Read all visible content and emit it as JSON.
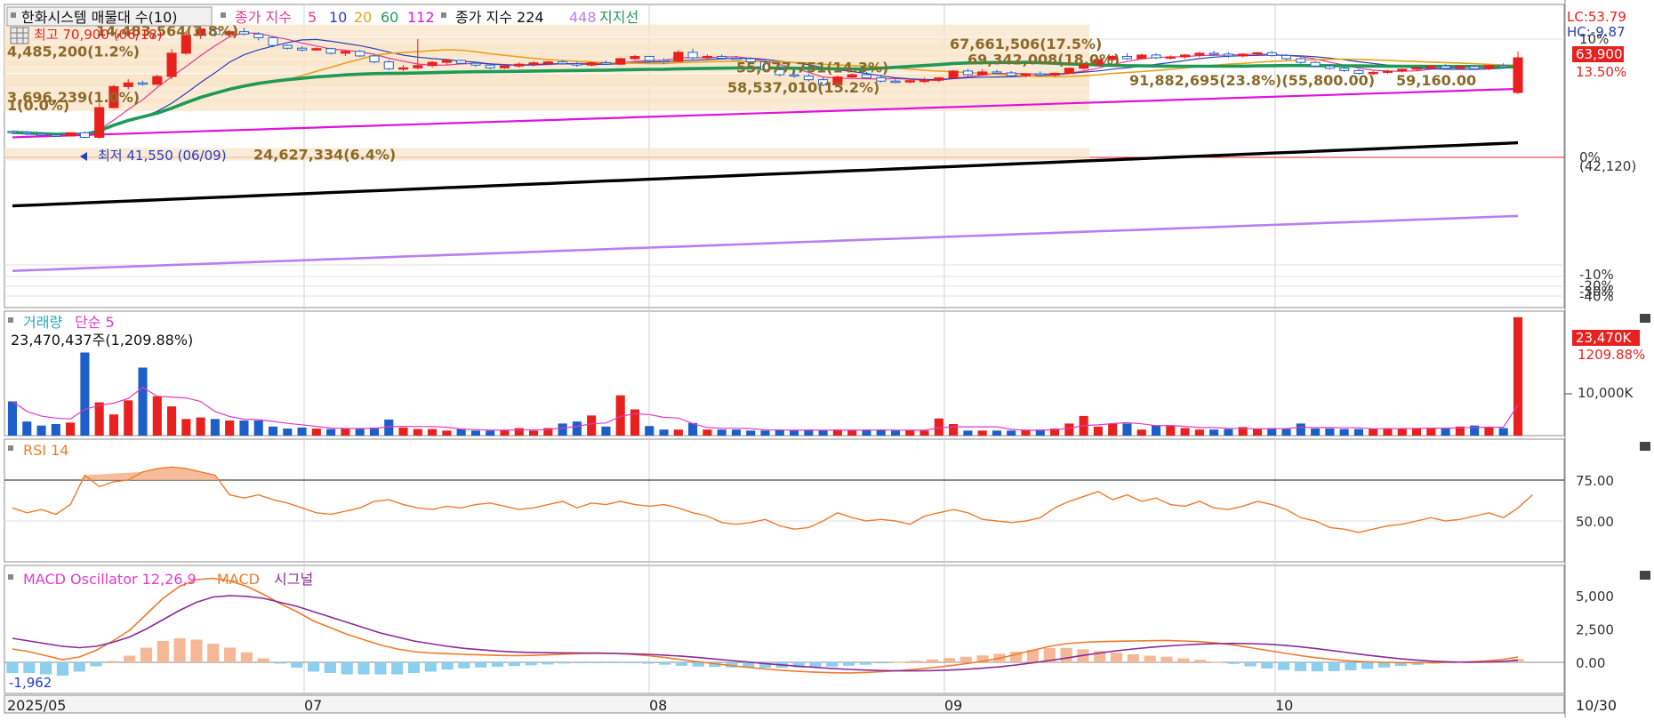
{
  "colors": {
    "up": "#e8201e",
    "down": "#1e5ec8",
    "ma5": "#e03a96",
    "ma10": "#2a3fb8",
    "ma20": "#e8a21c",
    "ma60": "#1e9a56",
    "ma112": "#e010e0",
    "ma224": "#000000",
    "ma448": "#b87ff0",
    "rsi": "#f07a2a",
    "macd": "#f07a2a",
    "signal": "#8a2a9a",
    "osc_pos": "#f5b896",
    "osc_neg": "#8ccfee",
    "volume_ma": "#e03ac8",
    "profile_band": "#f8e4c8",
    "annotation": "#8a6a2a"
  },
  "price_panel": {
    "legend": {
      "title": "한화시스템 매물대 수(10)",
      "ma_label": "종가 지수",
      "ma_periods": [
        "5",
        "10",
        "20",
        "60",
        "112"
      ],
      "ma2_label": "종가 지수 224",
      "ma2_extra": "448",
      "support": "지지선"
    },
    "high_label": "최고 70,900 (06/18)",
    "low_label": "최저 41,550 (06/09)",
    "lc_label": "LC:53.79",
    "hc_label": "HC:-9.87",
    "current_price": "63,900",
    "current_change": "13.50%",
    "right_scale": [
      {
        "label": "10%",
        "price": 67980
      },
      {
        "label": "0%",
        "price": 42120
      },
      {
        "label": "(42,120)",
        "price": 40150
      },
      {
        "label": "-10%",
        "price": 16500
      },
      {
        "label": "-20%",
        "price": 14000
      },
      {
        "label": "-30%",
        "price": 12800
      },
      {
        "label": "-40%",
        "price": 11700
      }
    ],
    "volume_profile": [
      {
        "label": "14,483,564(3.8%)",
        "price": 69800
      },
      {
        "label": "67,661,506(17.5%)",
        "price": 67000
      },
      {
        "label": "4,485,200(1.2%)",
        "price": 65400
      },
      {
        "label": "69,342,008(18.0%)",
        "price": 63600
      },
      {
        "label": "55,077,751(14.3%)",
        "price": 61900
      },
      {
        "label": "91,882,695(23.8%)(55,800.00)",
        "price": 59000
      },
      {
        "label": "59,160.00",
        "price": 59000
      },
      {
        "label": "58,537,010(15.2%)",
        "price": 57500
      },
      {
        "label": "3,696,239(1.0%)",
        "price": 55300
      },
      {
        "label": "1(0.0%)",
        "price": 53600
      },
      {
        "label": "24,627,334(6.4%)",
        "price": 42800
      }
    ]
  },
  "volume_panel": {
    "legend_label": "거래량",
    "legend_ma": "단순 5",
    "current": "23,470,437주(1,209.88%)",
    "badge": "23,470K",
    "badge_pct": "1209.88%",
    "scale_label": "10,000K"
  },
  "rsi_panel": {
    "legend": "RSI 14",
    "scale": [
      "75.00",
      "50.00"
    ]
  },
  "macd_panel": {
    "legend_osc": "MACD Oscillator 12,26,9",
    "legend_macd": "MACD",
    "legend_signal": "시그널",
    "min_label": "-1,962",
    "scale": [
      "5,000",
      "2,500",
      "0.00"
    ]
  },
  "x_axis": {
    "labels": [
      "2025/05",
      "07",
      "08",
      "09",
      "10"
    ],
    "end_label": "10/30"
  },
  "chart_data": {
    "type": "candlestick",
    "title": "한화시스템 매물대 수(10)",
    "dates_from": "2025/05",
    "dates_to": "10/30",
    "price_ylim": [
      11700,
      72000
    ],
    "candles": [
      [
        47800,
        48000,
        47200,
        47600
      ],
      [
        47600,
        47900,
        47000,
        47300
      ],
      [
        47300,
        47500,
        46700,
        47000
      ],
      [
        47000,
        47200,
        46600,
        46800
      ],
      [
        46800,
        47600,
        46700,
        47500
      ],
      [
        47500,
        47800,
        46300,
        46500
      ],
      [
        46500,
        54000,
        46200,
        53000
      ],
      [
        53000,
        58000,
        52800,
        57600
      ],
      [
        57600,
        59200,
        57000,
        58400
      ],
      [
        58400,
        58900,
        57800,
        58100
      ],
      [
        58100,
        60200,
        57800,
        59800
      ],
      [
        59800,
        65800,
        59200,
        64900
      ],
      [
        64900,
        69800,
        64600,
        68800
      ],
      [
        68800,
        70900,
        68000,
        70200
      ],
      [
        70200,
        70600,
        68500,
        69000
      ],
      [
        69000,
        69800,
        68400,
        69600
      ],
      [
        69600,
        70400,
        68800,
        69100
      ],
      [
        69100,
        69500,
        67700,
        68300
      ],
      [
        68300,
        68600,
        66200,
        66600
      ],
      [
        66600,
        66800,
        65700,
        66000
      ],
      [
        66000,
        66400,
        65300,
        65600
      ],
      [
        65600,
        66200,
        65400,
        65900
      ],
      [
        65900,
        66100,
        64600,
        64900
      ],
      [
        64900,
        65500,
        64300,
        65300
      ],
      [
        65300,
        65600,
        64100,
        64300
      ],
      [
        64300,
        64500,
        62700,
        63000
      ],
      [
        63000,
        63400,
        61200,
        61500
      ],
      [
        61500,
        62300,
        61000,
        61700
      ],
      [
        61700,
        68000,
        61300,
        62200
      ],
      [
        62200,
        63200,
        61800,
        62900
      ],
      [
        62900,
        63600,
        62300,
        63300
      ],
      [
        63300,
        63500,
        62500,
        62700
      ],
      [
        62700,
        63000,
        61900,
        62300
      ],
      [
        62300,
        62600,
        61400,
        61700
      ],
      [
        61700,
        62300,
        61500,
        62100
      ],
      [
        62100,
        62900,
        61700,
        62500
      ],
      [
        62500,
        63100,
        62000,
        62800
      ],
      [
        62800,
        63200,
        62300,
        63000
      ],
      [
        63000,
        63400,
        62400,
        62600
      ],
      [
        62600,
        63000,
        61900,
        62300
      ],
      [
        62300,
        63100,
        62000,
        62800
      ],
      [
        62800,
        63300,
        62300,
        62500
      ],
      [
        62500,
        63900,
        62300,
        63700
      ],
      [
        63700,
        64500,
        63400,
        64200
      ],
      [
        64200,
        64300,
        62800,
        63300
      ],
      [
        63300,
        63800,
        62600,
        63100
      ],
      [
        63100,
        65600,
        62900,
        65100
      ],
      [
        65100,
        65900,
        63500,
        63900
      ],
      [
        63900,
        64600,
        63400,
        64200
      ],
      [
        64200,
        64600,
        63500,
        63800
      ],
      [
        63800,
        64300,
        63400,
        63700
      ],
      [
        63700,
        64000,
        62600,
        63000
      ],
      [
        63000,
        63500,
        61000,
        61300
      ],
      [
        61300,
        61800,
        59800,
        60200
      ],
      [
        60200,
        60600,
        59500,
        59900
      ],
      [
        59900,
        60400,
        58700,
        59100
      ],
      [
        59100,
        59600,
        57700,
        58000
      ],
      [
        58000,
        60000,
        57900,
        59700
      ],
      [
        59700,
        60500,
        59500,
        60200
      ],
      [
        60200,
        60800,
        59300,
        59500
      ],
      [
        59500,
        60200,
        58500,
        58800
      ],
      [
        58800,
        59300,
        58300,
        58600
      ],
      [
        58600,
        59200,
        58300,
        58900
      ],
      [
        58900,
        59500,
        58400,
        59000
      ],
      [
        59000,
        59700,
        58600,
        59500
      ],
      [
        59500,
        61200,
        59300,
        61000
      ],
      [
        61000,
        61500,
        59800,
        60200
      ],
      [
        60200,
        61400,
        60000,
        60800
      ],
      [
        60800,
        61300,
        60400,
        60600
      ],
      [
        60600,
        61000,
        59800,
        60000
      ],
      [
        60000,
        60600,
        59600,
        60400
      ],
      [
        60400,
        60900,
        59900,
        60100
      ],
      [
        60100,
        60700,
        59700,
        60500
      ],
      [
        60500,
        61800,
        60300,
        61600
      ],
      [
        61600,
        62600,
        61300,
        62400
      ],
      [
        62400,
        63600,
        62200,
        63500
      ],
      [
        63500,
        64500,
        63300,
        64200
      ],
      [
        64200,
        64900,
        63400,
        63700
      ],
      [
        63700,
        64800,
        63600,
        64500
      ],
      [
        64500,
        64900,
        63600,
        63900
      ],
      [
        63900,
        64400,
        63500,
        64100
      ],
      [
        64100,
        64700,
        63700,
        64500
      ],
      [
        64500,
        65200,
        64000,
        64900
      ],
      [
        64900,
        65400,
        64400,
        64700
      ],
      [
        64700,
        65100,
        63900,
        64300
      ],
      [
        64300,
        64900,
        64000,
        64700
      ],
      [
        64700,
        65200,
        64300,
        65000
      ],
      [
        65000,
        65400,
        64100,
        64400
      ],
      [
        64400,
        64700,
        63400,
        63700
      ],
      [
        63700,
        64000,
        62600,
        62900
      ],
      [
        62900,
        63200,
        61800,
        62100
      ],
      [
        62100,
        62500,
        61300,
        61600
      ],
      [
        61600,
        62000,
        60800,
        61100
      ],
      [
        61100,
        61400,
        60200,
        60500
      ],
      [
        60500,
        61000,
        60100,
        60700
      ],
      [
        60700,
        61300,
        60400,
        61000
      ],
      [
        61000,
        61600,
        60700,
        61400
      ],
      [
        61400,
        62000,
        61100,
        61700
      ],
      [
        61700,
        62300,
        61400,
        62100
      ],
      [
        62100,
        62500,
        61300,
        61600
      ],
      [
        61600,
        62200,
        61400,
        62000
      ],
      [
        62000,
        62300,
        61300,
        61500
      ],
      [
        61500,
        62400,
        61200,
        62200
      ],
      [
        62200,
        62700,
        61800,
        62000
      ],
      [
        56300,
        65300,
        56000,
        63900
      ]
    ],
    "volume": [
      6.8,
      2.8,
      2.0,
      2.3,
      2.6,
      16.5,
      6.6,
      4.2,
      7.0,
      13.5,
      7.8,
      5.8,
      3.3,
      3.6,
      3.3,
      3.0,
      3.0,
      3.0,
      1.8,
      1.4,
      1.6,
      1.4,
      1.3,
      1.4,
      1.4,
      1.6,
      3.2,
      1.6,
      1.3,
      1.3,
      1.0,
      1.3,
      1.0,
      1.0,
      1.1,
      1.5,
      1.0,
      1.5,
      2.4,
      2.8,
      4.0,
      1.8,
      8.0,
      5.2,
      1.9,
      1.2,
      1.2,
      2.5,
      1.2,
      1.2,
      1.2,
      1.0,
      1.0,
      1.2,
      1.0,
      1.2,
      1.0,
      1.2,
      1.0,
      1.2,
      1.2,
      1.0,
      1.0,
      1.0,
      3.4,
      2.3,
      1.0,
      1.0,
      1.0,
      1.0,
      1.2,
      1.2,
      1.4,
      2.4,
      3.9,
      1.8,
      2.4,
      2.4,
      1.2,
      2.1,
      2.0,
      1.5,
      1.2,
      1.2,
      1.3,
      1.7,
      1.3,
      1.5,
      1.3,
      2.4,
      1.4,
      1.4,
      1.3,
      1.3,
      1.4,
      1.5,
      1.5,
      1.5,
      1.5,
      1.4,
      1.8,
      2.0,
      1.7,
      1.5,
      23.5
    ],
    "volume_unit": "million shares",
    "rsi": [
      58,
      55,
      57,
      54,
      60,
      78,
      71,
      74,
      75,
      80,
      82,
      83,
      82,
      80,
      78,
      66,
      64,
      66,
      63,
      61,
      58,
      55,
      54,
      56,
      58,
      62,
      63,
      60,
      58,
      57,
      59,
      58,
      60,
      61,
      59,
      57,
      58,
      60,
      62,
      58,
      61,
      60,
      62,
      60,
      59,
      60,
      58,
      55,
      53,
      49,
      48,
      49,
      51,
      47,
      45,
      46,
      50,
      55,
      52,
      50,
      51,
      50,
      48,
      53,
      55,
      57,
      55,
      51,
      50,
      49,
      50,
      52,
      58,
      62,
      65,
      68,
      63,
      66,
      62,
      64,
      60,
      59,
      62,
      58,
      57,
      59,
      62,
      60,
      57,
      52,
      50,
      46,
      45,
      43,
      45,
      47,
      48,
      50,
      52,
      50,
      51,
      53,
      55,
      52,
      58,
      66
    ],
    "rsi_ylim": [
      25,
      100
    ],
    "macd": [
      1000,
      800,
      500,
      200,
      400,
      900,
      1600,
      2400,
      3600,
      4800,
      5700,
      6200,
      6300,
      6100,
      5700,
      5100,
      4400,
      3800,
      3100,
      2600,
      2100,
      1700,
      1300,
      1000,
      800,
      700,
      650,
      600,
      560,
      520,
      500,
      520,
      560,
      620,
      660,
      680,
      660,
      600,
      500,
      360,
      200,
      40,
      -100,
      -250,
      -380,
      -500,
      -600,
      -680,
      -740,
      -780,
      -790,
      -760,
      -700,
      -620,
      -520,
      -400,
      -260,
      -100,
      80,
      300,
      600,
      900,
      1200,
      1400,
      1500,
      1550,
      1580,
      1600,
      1620,
      1640,
      1600,
      1550,
      1450,
      1300,
      1100,
      900,
      700,
      500,
      340,
      200,
      100,
      40,
      0,
      -20,
      -30,
      -20,
      0,
      40,
      100,
      200,
      400
    ],
    "signal": [
      1800,
      1600,
      1400,
      1200,
      1100,
      1200,
      1500,
      1900,
      2500,
      3200,
      3900,
      4500,
      4900,
      5000,
      4950,
      4800,
      4500,
      4200,
      3800,
      3400,
      3000,
      2600,
      2200,
      1900,
      1600,
      1400,
      1200,
      1050,
      950,
      850,
      780,
      740,
      720,
      710,
      700,
      690,
      670,
      640,
      600,
      540,
      460,
      360,
      250,
      130,
      20,
      -90,
      -190,
      -290,
      -380,
      -460,
      -530,
      -580,
      -620,
      -640,
      -640,
      -620,
      -580,
      -520,
      -440,
      -340,
      -200,
      -40,
      130,
      320,
      520,
      700,
      860,
      1000,
      1120,
      1220,
      1300,
      1360,
      1400,
      1420,
      1400,
      1360,
      1280,
      1160,
      1020,
      860,
      700,
      540,
      390,
      260,
      160,
      80,
      30,
      10,
      20,
      60,
      160
    ],
    "macd_ylim": [
      -2200,
      7000
    ]
  }
}
